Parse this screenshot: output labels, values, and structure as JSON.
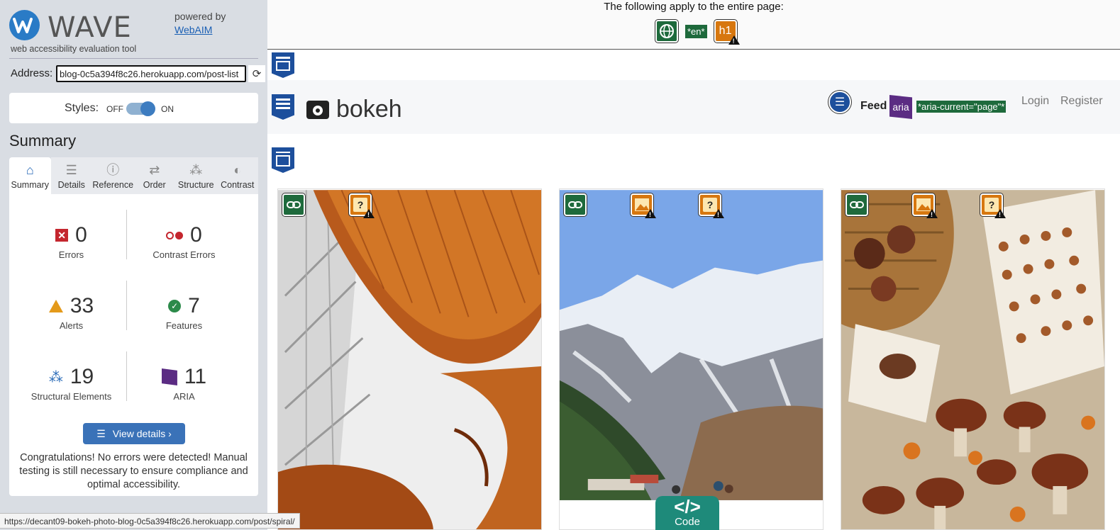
{
  "sidebar": {
    "logo_text": "WAVE",
    "tagline": "web accessibility evaluation tool",
    "powered_by": "powered by",
    "webaim_link": "WebAIM",
    "address_label": "Address:",
    "address_value": "blog-0c5a394f8c26.herokuapp.com/post-list",
    "styles_label": "Styles:",
    "styles_off": "OFF",
    "styles_on": "ON",
    "summary_title": "Summary",
    "tabs": [
      {
        "label": "Summary",
        "icon": "home-icon"
      },
      {
        "label": "Details",
        "icon": "list-icon"
      },
      {
        "label": "Reference",
        "icon": "info-icon"
      },
      {
        "label": "Order",
        "icon": "order-icon"
      },
      {
        "label": "Structure",
        "icon": "structure-icon"
      },
      {
        "label": "Contrast",
        "icon": "contrast-icon"
      }
    ],
    "stats": {
      "errors": {
        "value": "0",
        "label": "Errors"
      },
      "contrast_errors": {
        "value": "0",
        "label": "Contrast Errors"
      },
      "alerts": {
        "value": "33",
        "label": "Alerts"
      },
      "features": {
        "value": "7",
        "label": "Features"
      },
      "structural": {
        "value": "19",
        "label": "Structural Elements"
      },
      "aria": {
        "value": "11",
        "label": "ARIA"
      }
    },
    "view_details": "View details ›",
    "congrats": "Congratulations! No errors were detected! Manual testing is still necessary to ensure compliance and optimal accessibility."
  },
  "status_url": "https://decant09-bokeh-photo-blog-0c5a394f8c26.herokuapp.com/post/spiral/",
  "main": {
    "banner_text": "The following apply to the entire page:",
    "lang_tag": "*en*",
    "h1_tag": "h1",
    "brand": "bokeh",
    "nav_feed": "Feed",
    "aria_tag": "aria",
    "aria_current": "*aria-current=\"page\"*",
    "nav_login": "Login",
    "nav_register": "Register",
    "code_button": "Code",
    "code_glyph": "</>",
    "question_mark": "?"
  },
  "colors": {
    "wave_blue": "#2a7bc6",
    "error_red": "#c4262e",
    "alert_orange": "#e49a1a",
    "feature_green": "#2c8a4a",
    "structure_blue": "#1d4f9c",
    "aria_purple": "#5b2c83"
  }
}
